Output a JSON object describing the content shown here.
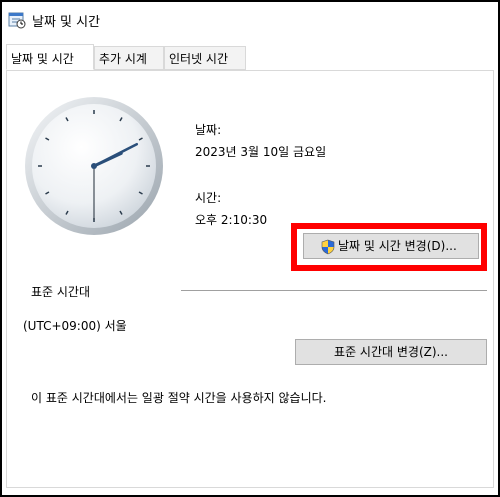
{
  "window": {
    "title": "날짜 및 시간",
    "icon": "date-time-icon"
  },
  "tabs": [
    {
      "label": "날짜 및 시간",
      "active": true
    },
    {
      "label": "추가 시계",
      "active": false
    },
    {
      "label": "인터넷 시간",
      "active": false
    }
  ],
  "datetime": {
    "date_label": "날짜:",
    "date_value": "2023년 3월 10일 금요일",
    "time_label": "시간:",
    "time_value": "오후 2:10:30",
    "change_button": "날짜 및 시간 변경(D)..."
  },
  "timezone": {
    "section_label": "표준 시간대",
    "value": "(UTC+09:00) 서울",
    "change_button": "표준 시간대 변경(Z)..."
  },
  "dst_note": "이 표준 시간대에서는 일광 절약 시간을 사용하지 않습니다.",
  "clock": {
    "hours": 2,
    "minutes": 10,
    "seconds": 30
  },
  "colors": {
    "highlight": "#ff0000",
    "button_bg": "#e1e1e1",
    "border": "#d9d9d9"
  }
}
